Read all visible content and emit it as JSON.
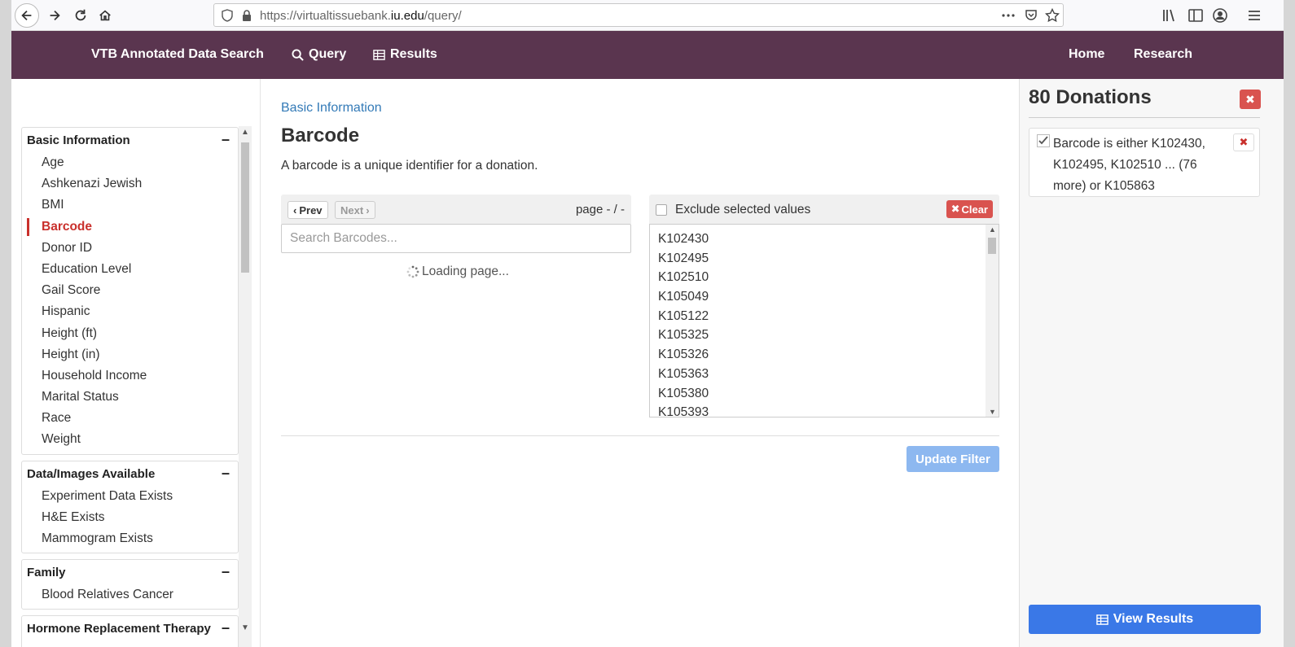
{
  "browser": {
    "url_prefix": "https://virtualtissuebank.",
    "url_domain": "iu.edu",
    "url_path": "/query/"
  },
  "navbar": {
    "brand": "VTB Annotated Data Search",
    "query": "Query",
    "results": "Results",
    "home": "Home",
    "research": "Research"
  },
  "sidebar": {
    "panels": [
      {
        "title": "Basic Information",
        "items": [
          "Age",
          "Ashkenazi Jewish",
          "BMI",
          "Barcode",
          "Donor ID",
          "Education Level",
          "Gail Score",
          "Hispanic",
          "Height (ft)",
          "Height (in)",
          "Household Income",
          "Marital Status",
          "Race",
          "Weight"
        ]
      },
      {
        "title": "Data/Images Available",
        "items": [
          "Experiment Data Exists",
          "H&E Exists",
          "Mammogram Exists"
        ]
      },
      {
        "title": "Family",
        "items": [
          "Blood Relatives Cancer"
        ]
      },
      {
        "title": "Hormone Replacement Therapy",
        "items": []
      }
    ],
    "collapse_symbol": "–",
    "active_item": "Barcode"
  },
  "main": {
    "breadcrumb": "Basic Information",
    "title": "Barcode",
    "description": "A barcode is a unique identifier for a donation.",
    "prev_label": "Prev",
    "next_label": "Next",
    "page_info": "page - / -",
    "search_placeholder": "Search Barcodes...",
    "loading_text": "Loading page...",
    "exclude_label": "Exclude selected values",
    "clear_label": "Clear",
    "selected_values": [
      "K102430",
      "K102495",
      "K102510",
      "K105049",
      "K105122",
      "K105325",
      "K105326",
      "K105363",
      "K105380",
      "K105393"
    ],
    "update_label": "Update Filter"
  },
  "rightpanel": {
    "title": "80 Donations",
    "filter_text": "Barcode is either K102430, K102495, K102510 ... (76 more) or K105863",
    "view_results": "View Results"
  },
  "colors": {
    "navbar": "#5a354f",
    "active": "#c9302c",
    "link": "#337ab7",
    "danger": "#d9534f",
    "primary": "#3a78e7"
  }
}
